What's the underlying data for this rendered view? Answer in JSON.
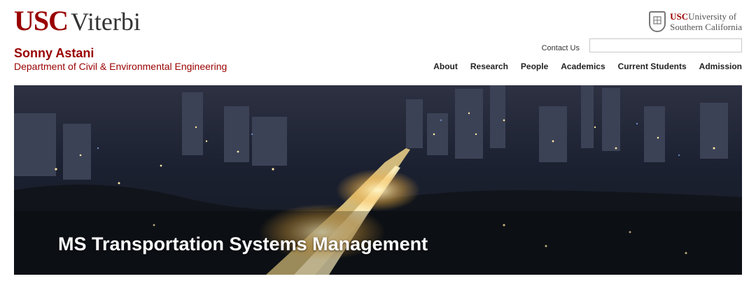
{
  "header": {
    "logo": {
      "usc": "USC",
      "viterbi": "Viterbi"
    },
    "school_name": "Sonny Astani",
    "department": "Department of Civil & Environmental Engineering",
    "university_logo": {
      "usc": "USC",
      "line1": "University of",
      "line2": "Southern California"
    },
    "contact_label": "Contact Us",
    "search": {
      "value": "",
      "placeholder": ""
    }
  },
  "nav": {
    "items": [
      "About",
      "Research",
      "People",
      "Academics",
      "Current Students",
      "Admission"
    ]
  },
  "hero": {
    "title": "MS Transportation Systems Management"
  },
  "colors": {
    "brand": "#990000",
    "nav_text": "#222222"
  }
}
